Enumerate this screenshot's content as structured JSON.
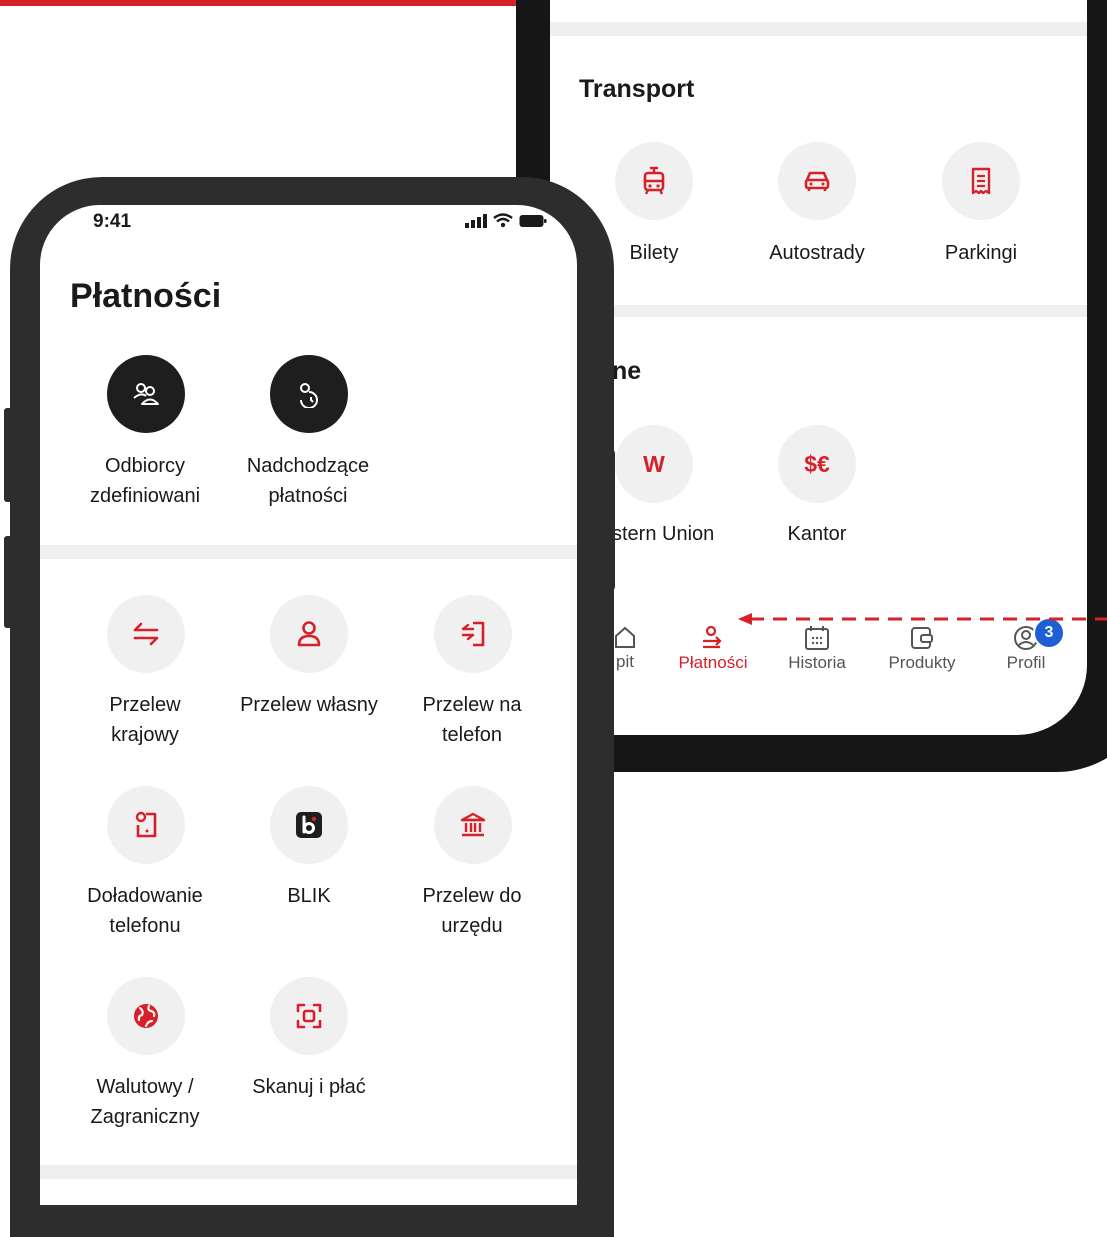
{
  "back_screen": {
    "transport": {
      "title": "Transport",
      "items": [
        {
          "label": "Bilety",
          "icon": "tram-icon"
        },
        {
          "label": "Autostrady",
          "icon": "car-icon"
        },
        {
          "label": "Parkingi",
          "icon": "receipt-icon"
        }
      ]
    },
    "other": {
      "title": "ne",
      "items": [
        {
          "label": "stern Union",
          "icon_text": "W"
        },
        {
          "label": "Kantor",
          "icon_text": "$€"
        }
      ]
    },
    "nav": {
      "items": [
        {
          "label": "pit"
        },
        {
          "label": "Płatności"
        },
        {
          "label": "Historia"
        },
        {
          "label": "Produkty"
        },
        {
          "label": "Profil",
          "badge": "3"
        }
      ],
      "active": "Płatności"
    }
  },
  "front_screen": {
    "status": {
      "time": "9:41"
    },
    "title": "Płatności",
    "quick": [
      {
        "line1": "Odbiorcy",
        "line2": "zdefiniowani"
      },
      {
        "line1": "Nadchodzące",
        "line2": "płatności"
      }
    ],
    "grid": [
      {
        "line1": "Przelew",
        "line2": "krajowy"
      },
      {
        "line1": "Przelew własny",
        "line2": ""
      },
      {
        "line1": "Przelew na",
        "line2": "telefon"
      },
      {
        "line1": "Doładowanie",
        "line2": "telefonu"
      },
      {
        "line1": "BLIK",
        "line2": ""
      },
      {
        "line1": "Przelew do",
        "line2": "urzędu"
      },
      {
        "line1": "Walutowy /",
        "line2": "Zagraniczny"
      },
      {
        "line1": "Skanuj i płać",
        "line2": ""
      }
    ]
  },
  "colors": {
    "accent": "#d6202a",
    "badge": "#1f5fd6",
    "frame": "#2d2d2d"
  }
}
